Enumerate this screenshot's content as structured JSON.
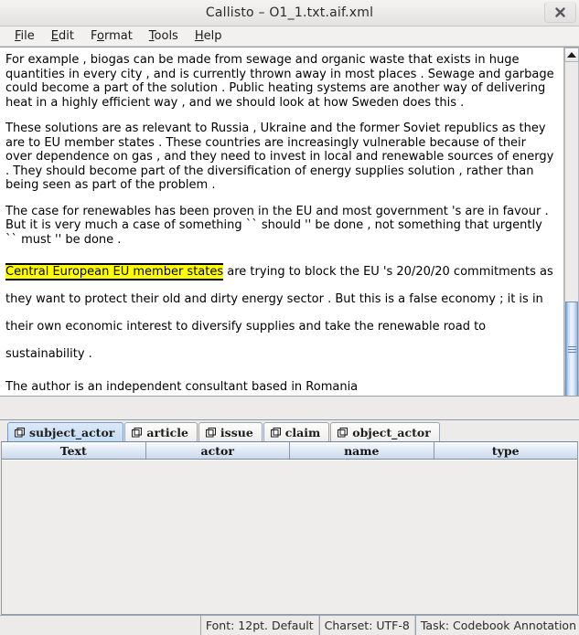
{
  "window": {
    "title": "Callisto – O1_1.txt.aif.xml",
    "close_label": "x"
  },
  "menubar": {
    "items": [
      {
        "pre": "",
        "mnemonic": "F",
        "post": "ile"
      },
      {
        "pre": "",
        "mnemonic": "E",
        "post": "dit"
      },
      {
        "pre": "F",
        "mnemonic": "o",
        "post": "rmat"
      },
      {
        "pre": "",
        "mnemonic": "T",
        "post": "ools"
      },
      {
        "pre": "",
        "mnemonic": "H",
        "post": "elp"
      }
    ]
  },
  "editor": {
    "paragraphs": [
      {
        "kind": "normal",
        "text": "For example , biogas can be made from sewage and organic waste that exists in huge quantities in every city , and is currently thrown away in most places .  Sewage and garbage could become a part of the solution .  Public heating systems are another way of delivering heat in a highly efficient way , and we should look at how Sweden does this ."
      },
      {
        "kind": "normal",
        "text": "These solutions are as relevant to Russia , Ukraine and the former Soviet republics as they are to EU member states .  These countries are increasingly vulnerable because of their over dependence on gas , and they need to invest in local and renewable sources of energy .  They should become part of the diversification of energy supplies solution , rather than being seen as part of the problem ."
      },
      {
        "kind": "normal",
        "text": "The case for renewables has been proven in the EU and most government 's are in favour .  But it is very much a case of something `` should '' be done , not something that urgently `` must '' be done ."
      },
      {
        "kind": "highlighted",
        "highlight": "Central European EU member states",
        "text": " are trying to block the EU 's 20/20/20 commitments as they want to protect their old and dirty energy sector .  But this is a false economy ; it is in their own economic interest to diversify supplies and take the renewable road to sustainability ."
      },
      {
        "kind": "normal",
        "text": "The author is an independent consultant based in Romania"
      }
    ],
    "highlight_color": "#ffff00"
  },
  "tabs": [
    {
      "label": "subject_actor",
      "active": true
    },
    {
      "label": "article",
      "active": false
    },
    {
      "label": "issue",
      "active": false
    },
    {
      "label": "claim",
      "active": false
    },
    {
      "label": "object_actor",
      "active": false
    }
  ],
  "table": {
    "columns": [
      "Text",
      "actor",
      "name",
      "type"
    ],
    "rows": []
  },
  "statusbar": {
    "cells": [
      "Font: 12pt. Default",
      "Charset: UTF-8",
      "Task: Codebook Annotation"
    ]
  }
}
